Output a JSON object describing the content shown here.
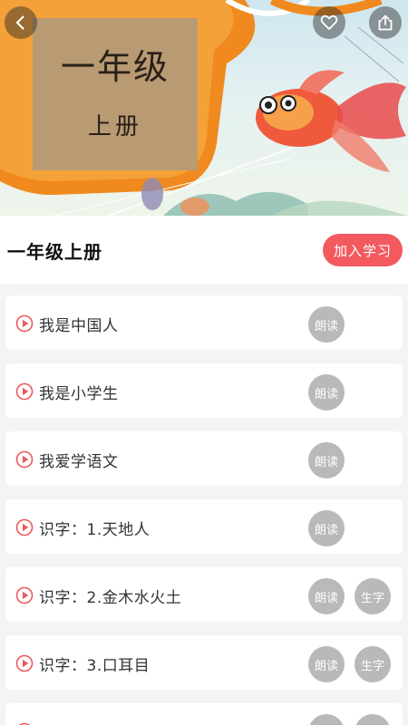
{
  "banner": {
    "cover_title": "一年级",
    "cover_subtitle": "上册",
    "icons": [
      "back-icon",
      "heart-icon",
      "share-icon"
    ]
  },
  "book": {
    "title": "一年级上册",
    "join_label": "加入学习"
  },
  "lessons": [
    {
      "label": "我是中国人",
      "read": "朗读",
      "chars": ""
    },
    {
      "label": "我是小学生",
      "read": "朗读",
      "chars": ""
    },
    {
      "label": "我爱学语文",
      "read": "朗读",
      "chars": ""
    },
    {
      "label": "识字：1.天地人",
      "read": "朗读",
      "chars": ""
    },
    {
      "label": "识字：2.金木水火土",
      "read": "朗读",
      "chars": "生字"
    },
    {
      "label": "识字：3.口耳目",
      "read": "朗读",
      "chars": "生字"
    },
    {
      "label": "",
      "read": "",
      "chars": ""
    }
  ],
  "colors": {
    "accent": "#f25a60",
    "pill": "#b9b9b9",
    "play": "#ee5a5a",
    "cover_card": "#b89a73",
    "orange": "#f08a1e"
  }
}
